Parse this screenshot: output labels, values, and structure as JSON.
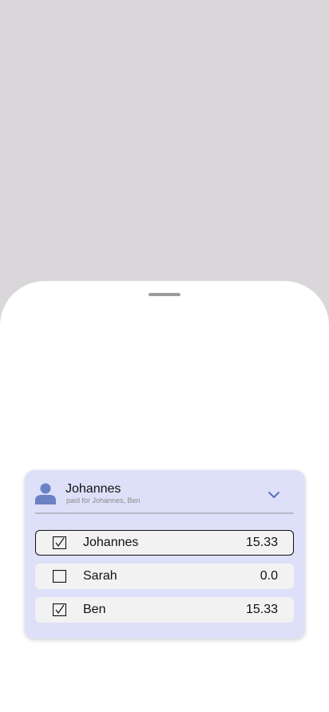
{
  "payer": {
    "name": "Johannes",
    "subtitle": "paid for Johannes, Ben",
    "icon": "person-icon"
  },
  "split": {
    "rows": [
      {
        "name": "Johannes",
        "amount": "15.33",
        "checked": true
      },
      {
        "name": "Sarah",
        "amount": "0.0",
        "checked": false
      },
      {
        "name": "Ben",
        "amount": "15.33",
        "checked": true
      }
    ]
  },
  "colors": {
    "card_bg": "#dde0f8",
    "avatar": "#6a82c4",
    "chevron": "#5b72b8",
    "scrim": "#d9d7d9"
  }
}
